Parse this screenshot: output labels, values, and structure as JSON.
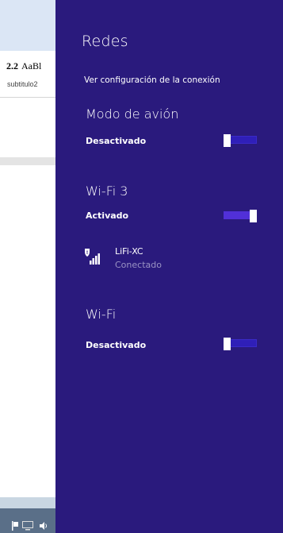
{
  "background_app": {
    "style_name_number": "2.2",
    "style_name_sample": "AaBl",
    "style_subtitle": "subtitulo2"
  },
  "panel": {
    "title": "Redes",
    "settings_link": "Ver configuración de la conexión",
    "sections": [
      {
        "name": "Modo de avión",
        "state": "Desactivado",
        "toggle_on": false
      },
      {
        "name": "Wi-Fi 3",
        "state": "Activado",
        "toggle_on": true
      },
      {
        "name": "Wi-Fi",
        "state": "Desactivado",
        "toggle_on": false
      }
    ],
    "network": {
      "name": "LiFi-XC",
      "status": "Conectado",
      "icon": "wifi-secured-icon"
    }
  },
  "colors": {
    "panel_bg": "#2a1a7d",
    "toggle_track_off": "#2f1fb8",
    "toggle_track_on": "#5130d8",
    "taskbar": "#5a6f88"
  }
}
